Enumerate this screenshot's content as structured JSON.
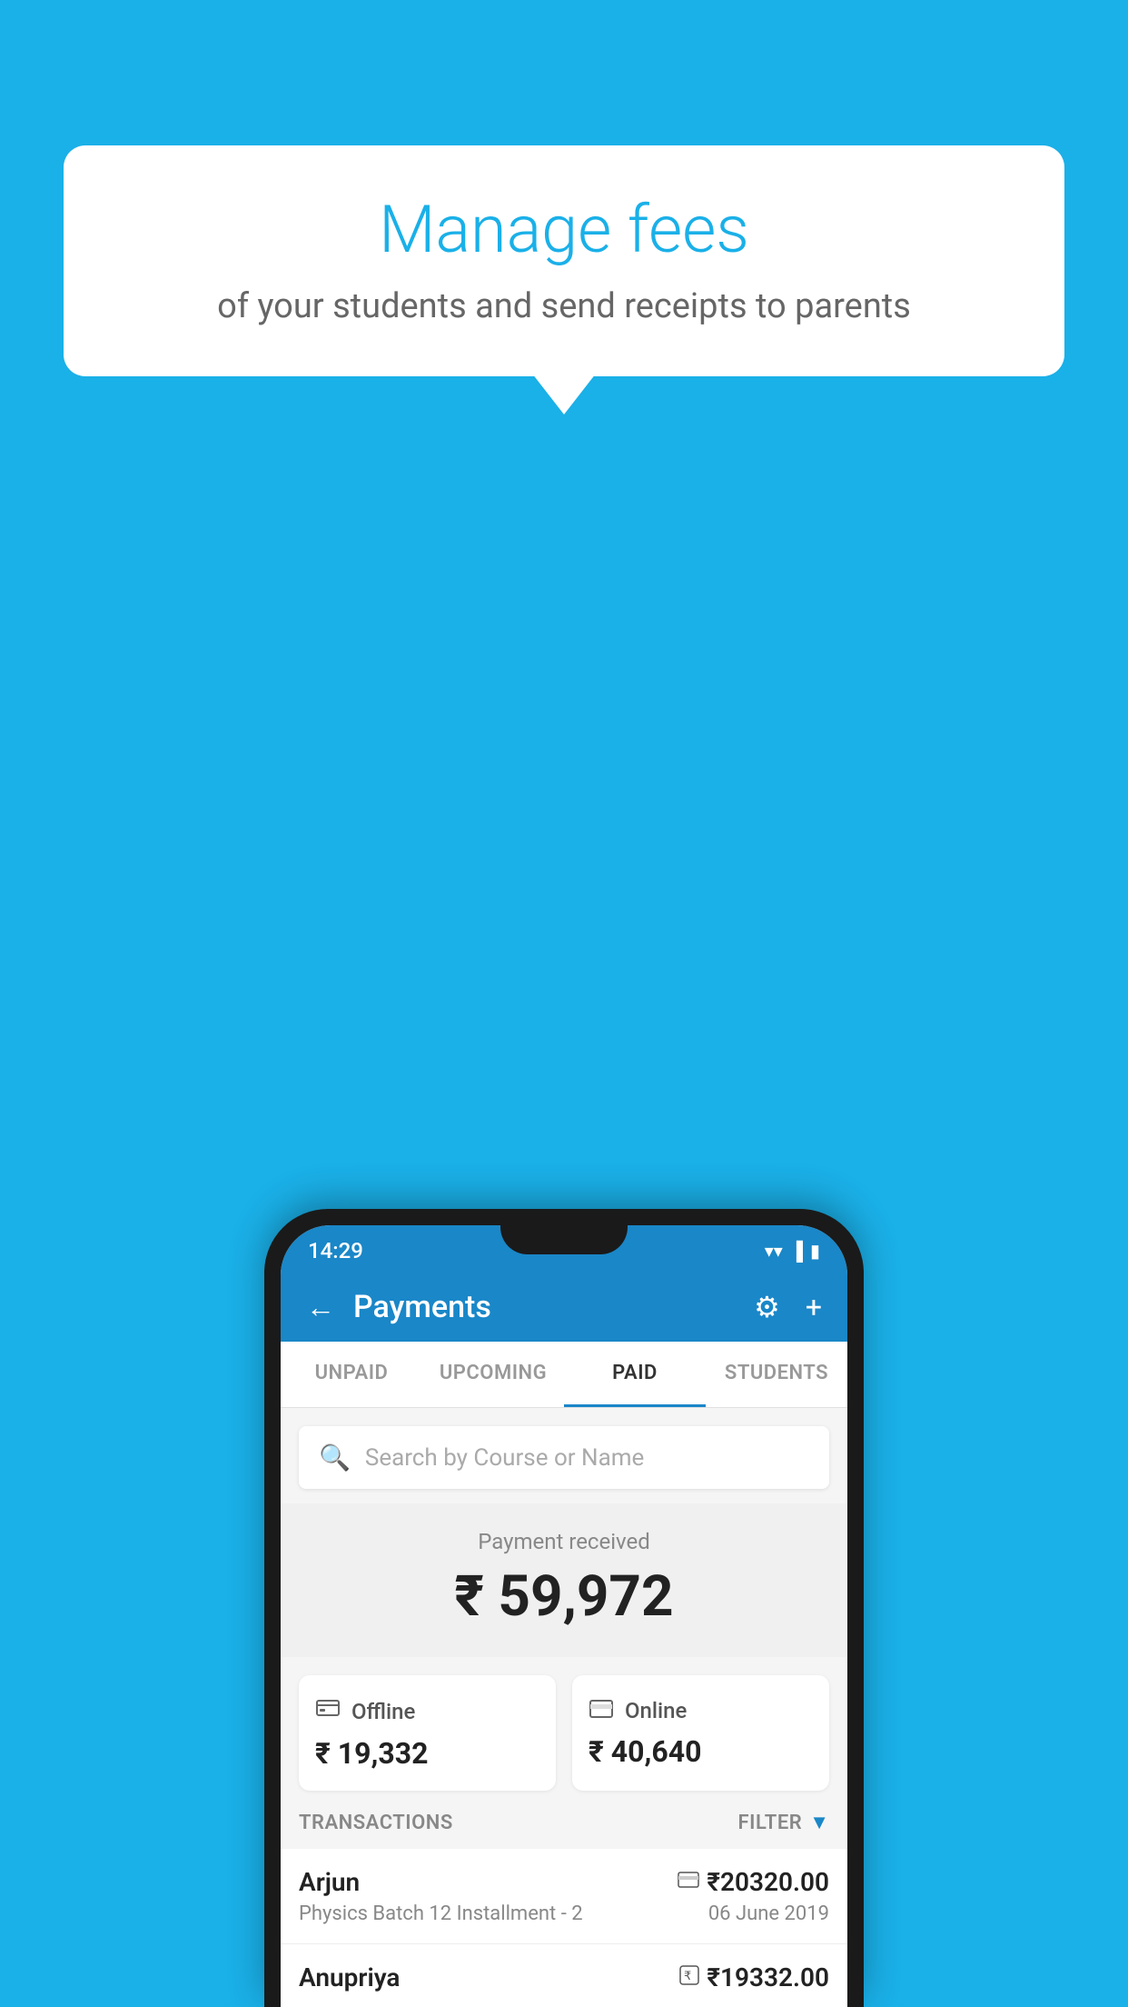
{
  "background_color": "#1ab0e8",
  "tooltip": {
    "title": "Manage fees",
    "subtitle": "of your students and send receipts to parents"
  },
  "status_bar": {
    "time": "14:29",
    "icons": [
      "wifi",
      "signal",
      "battery"
    ]
  },
  "toolbar": {
    "title": "Payments",
    "back_label": "←",
    "settings_label": "⚙",
    "add_label": "+"
  },
  "tabs": [
    {
      "label": "UNPAID",
      "active": false
    },
    {
      "label": "UPCOMING",
      "active": false
    },
    {
      "label": "PAID",
      "active": true
    },
    {
      "label": "STUDENTS",
      "active": false
    }
  ],
  "search": {
    "placeholder": "Search by Course or Name"
  },
  "payment_received": {
    "label": "Payment received",
    "amount": "₹ 59,972"
  },
  "payment_cards": [
    {
      "icon": "₹",
      "label": "Offline",
      "amount": "₹ 19,332"
    },
    {
      "icon": "▬",
      "label": "Online",
      "amount": "₹ 40,640"
    }
  ],
  "transactions_section": {
    "label": "TRANSACTIONS",
    "filter_label": "FILTER"
  },
  "transactions": [
    {
      "name": "Arjun",
      "payment_type": "card",
      "amount": "₹20320.00",
      "course": "Physics Batch 12 Installment - 2",
      "date": "06 June 2019"
    },
    {
      "name": "Anupriya",
      "payment_type": "rupee",
      "amount": "₹19332.00",
      "course": "",
      "date": ""
    }
  ]
}
